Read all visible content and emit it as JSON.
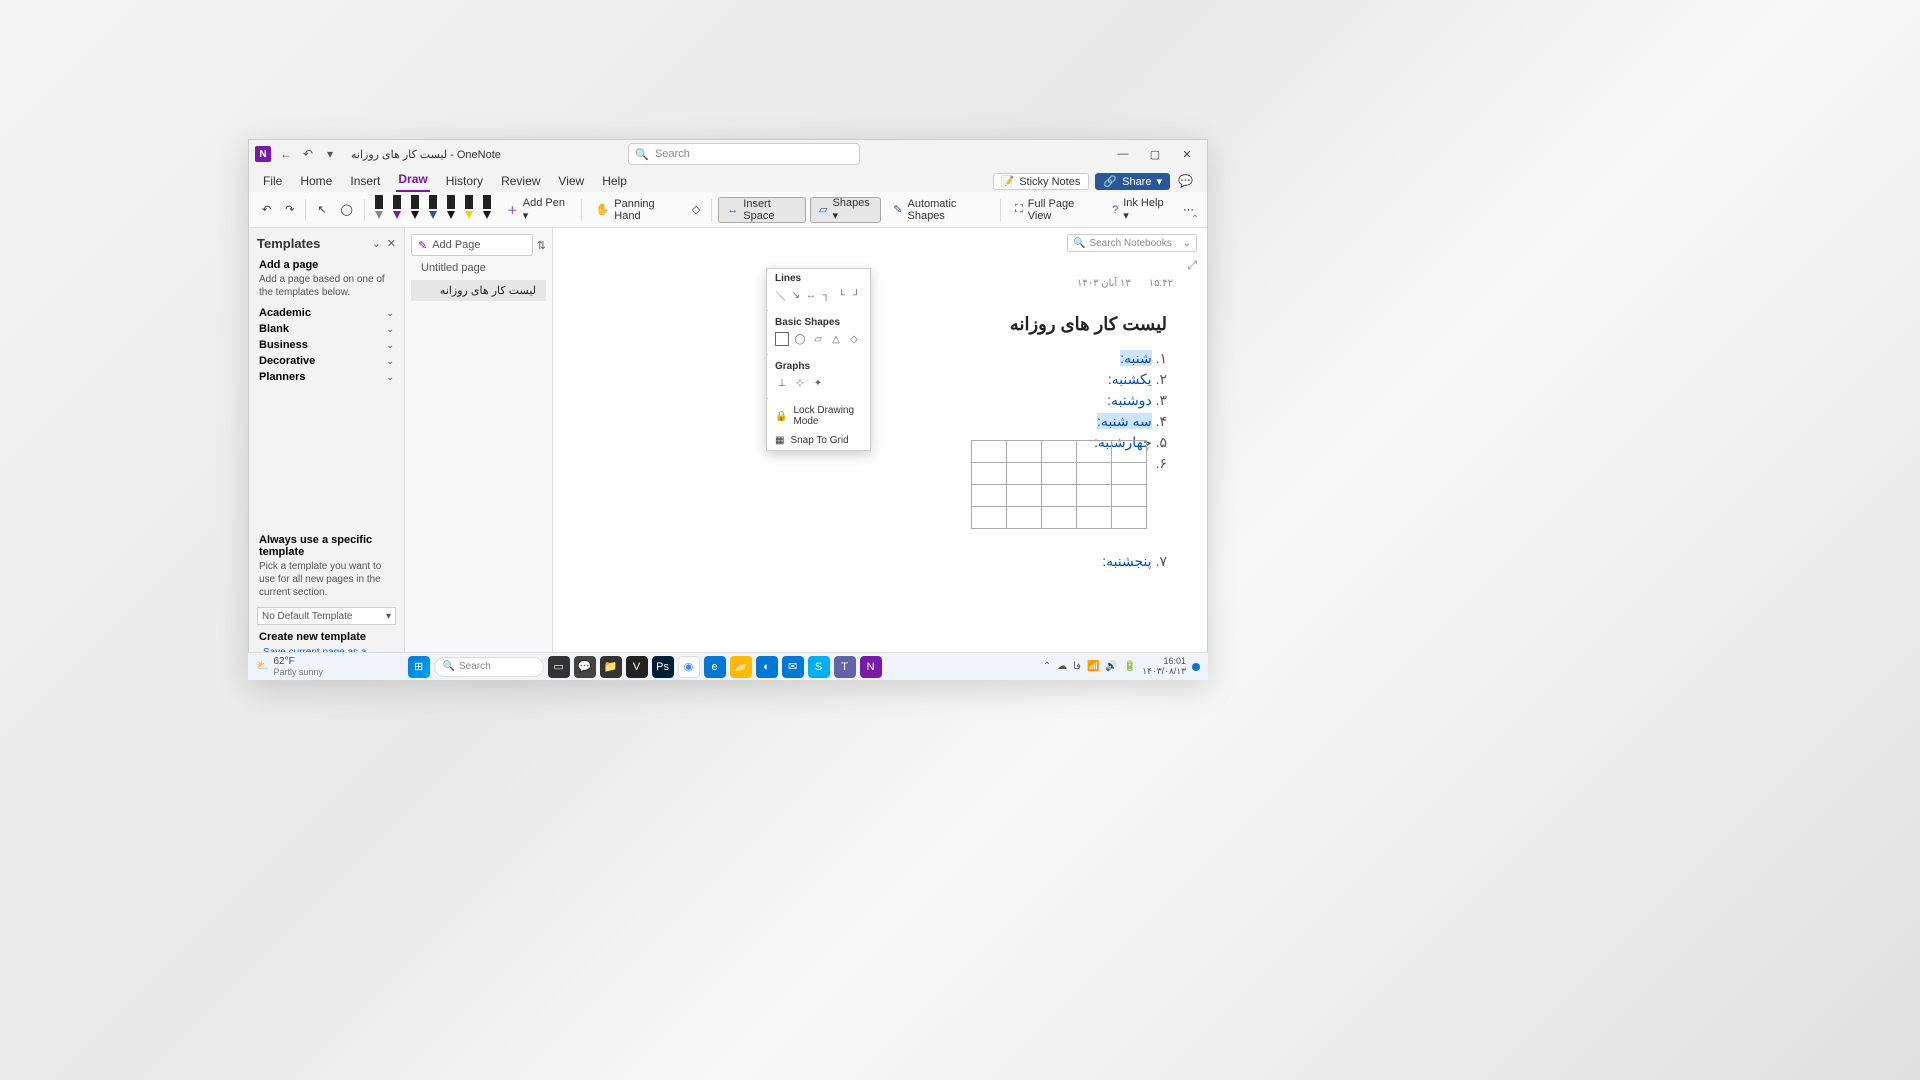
{
  "titlebar": {
    "app_icon": "N",
    "doc_title": "لیست کار های روزانه - OneNote",
    "search_placeholder": "Search"
  },
  "window_controls": {
    "min": "—",
    "max": "▢",
    "close": "✕"
  },
  "menus": {
    "file": "File",
    "home": "Home",
    "insert": "Insert",
    "draw": "Draw",
    "history": "History",
    "review": "Review",
    "view": "View",
    "help": "Help"
  },
  "menubar_right": {
    "sticky": "Sticky Notes",
    "share": "Share"
  },
  "ribbon": {
    "undo": "↶",
    "redo": "↷",
    "select": "▭",
    "lasso": "◯",
    "add_pen": "Add Pen ▾",
    "panning": "Panning Hand",
    "eraser": "✎",
    "insert_space": "Insert Space",
    "shapes": "Shapes ▾",
    "auto_shapes": "Automatic Shapes",
    "full_page": "Full Page View",
    "ink_help": "Ink Help ▾",
    "more": "⋯",
    "pens": [
      {
        "tip": "#888",
        "body": "#222"
      },
      {
        "tip": "#7719aa",
        "body": "#222"
      },
      {
        "tip": "#111",
        "body": "#222"
      },
      {
        "tip": "#2b579a",
        "body": "#222"
      },
      {
        "tip": "#111",
        "body": "#222"
      },
      {
        "tip": "#ffcc00",
        "body": "#222"
      },
      {
        "tip": "#111",
        "body": "#222"
      }
    ]
  },
  "templates": {
    "header": "Templates",
    "add_page_header": "Add a page",
    "add_page_desc": "Add a page based on one of the templates below.",
    "cats": [
      "Academic",
      "Blank",
      "Business",
      "Decorative",
      "Planners"
    ],
    "always_header": "Always use a specific template",
    "always_desc": "Pick a template you want to use for all new pages in the current section.",
    "combo_value": "No Default Template",
    "create_header": "Create new template",
    "save_link": "Save current page as a template"
  },
  "pagelist": {
    "add_page": "Add Page",
    "pages": [
      {
        "title": "Untitled page",
        "selected": false
      },
      {
        "title": "لیست کار های روزانه",
        "selected": true
      }
    ]
  },
  "canvas": {
    "search_nb": "Search Notebooks",
    "meta_date": "۱۳ آبان ۱۴۰۳",
    "meta_time": "۱۵:۴۲",
    "title": "لیست کار های روزانه",
    "items": [
      {
        "n": "۱.",
        "txt": "شنبه:",
        "hl": true
      },
      {
        "n": "۲.",
        "txt": "یکشنبه:",
        "hl": false
      },
      {
        "n": "۳.",
        "txt": "دوشنبه:",
        "hl": false
      },
      {
        "n": "۴.",
        "txt": "سه شنبه:",
        "hl": true
      },
      {
        "n": "۵.",
        "txt": "چهارشنبه:",
        "hl": false
      },
      {
        "n": "۶.",
        "txt": "",
        "hl": false
      },
      {
        "n": "۷.",
        "txt": "پنجشنبه:",
        "hl": false
      }
    ]
  },
  "shapes_popup": {
    "lines": "Lines",
    "basic": "Basic Shapes",
    "graphs": "Graphs",
    "lock": "Lock Drawing Mode",
    "snap": "Snap To Grid"
  },
  "taskbar": {
    "temp": "62°F",
    "weather": "Partly sunny",
    "search": "Search",
    "time": "16:01",
    "date": "۱۴۰۳/۰۸/۱۳"
  }
}
